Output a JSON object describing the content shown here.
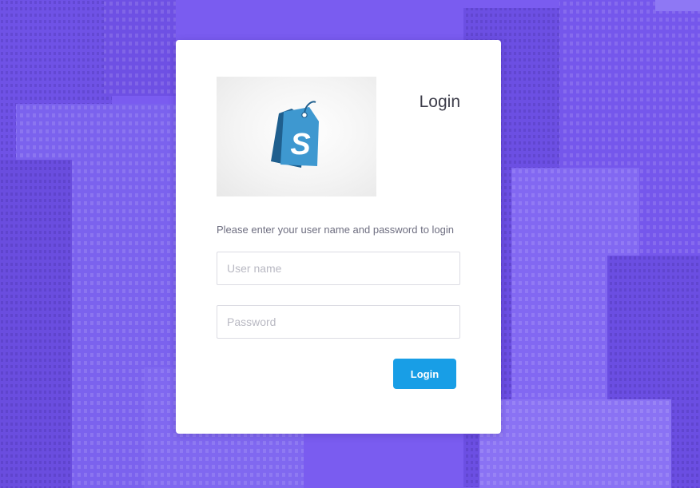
{
  "login_card": {
    "title": "Login",
    "instructions": "Please enter your user name and password to login",
    "logo_icon": "shopping-tag-icon",
    "logo_letter": "S",
    "username": {
      "value": "",
      "placeholder": "User name"
    },
    "password": {
      "value": "",
      "placeholder": "Password"
    },
    "login_button_label": "Login"
  },
  "colors": {
    "background_overlay": "#7a5cf0",
    "card": "#ffffff",
    "button": "#189ee6",
    "logo_tag_front": "#3e98d0",
    "logo_tag_back": "#1f5f8e"
  }
}
